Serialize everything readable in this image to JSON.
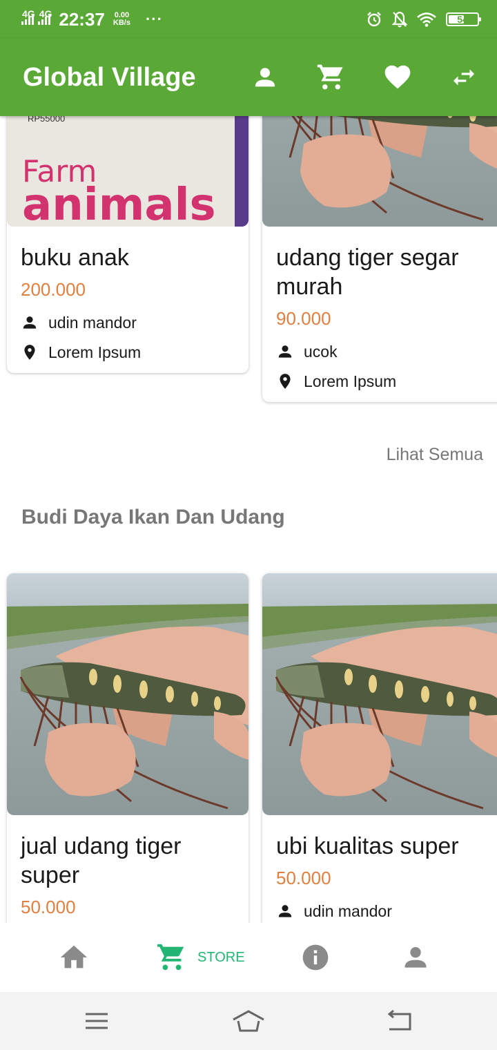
{
  "status_bar": {
    "network_1": "4G",
    "network_2": "4G",
    "time": "22:37",
    "speed_value": "0.00",
    "speed_unit": "KB/s",
    "more": "···",
    "battery_level": "54",
    "icons": [
      "alarm-icon",
      "notifications-off-icon",
      "wifi-icon",
      "battery-icon"
    ]
  },
  "app_bar": {
    "title": "Global Village",
    "actions": [
      "person-icon",
      "cart-icon",
      "favorite-icon",
      "swap-icon"
    ]
  },
  "top_row": [
    {
      "title": "buku anak",
      "price": "200.000",
      "seller": "udin mandor",
      "location": "Lorem Ipsum",
      "image": "farm-animals-book"
    },
    {
      "title": "udang tiger segar murah",
      "price": "90.000",
      "seller": "ucok",
      "location": "Lorem Ipsum",
      "image": "tiger-shrimp"
    }
  ],
  "see_all": "Lihat Semua",
  "section": {
    "title": "Budi Daya Ikan Dan Udang",
    "items": [
      {
        "title": "jual udang tiger super",
        "price": "50.000",
        "image": "tiger-shrimp"
      },
      {
        "title": "ubi kualitas super",
        "price": "50.000",
        "seller": "udin mandor",
        "image": "tiger-shrimp"
      }
    ]
  },
  "book_cover": {
    "price_tag": "RP55000",
    "line1": "Farm",
    "line2": "animals"
  },
  "bottom_nav": {
    "items": [
      {
        "icon": "home-icon",
        "label": ""
      },
      {
        "icon": "store-cart-icon",
        "label": "STORE"
      },
      {
        "icon": "info-icon",
        "label": ""
      },
      {
        "icon": "account-icon",
        "label": ""
      }
    ],
    "active_index": 1
  },
  "colors": {
    "primary": "#5aa937",
    "price": "#e08040",
    "active_nav": "#22b573",
    "inactive_nav": "#8a8a8a"
  }
}
